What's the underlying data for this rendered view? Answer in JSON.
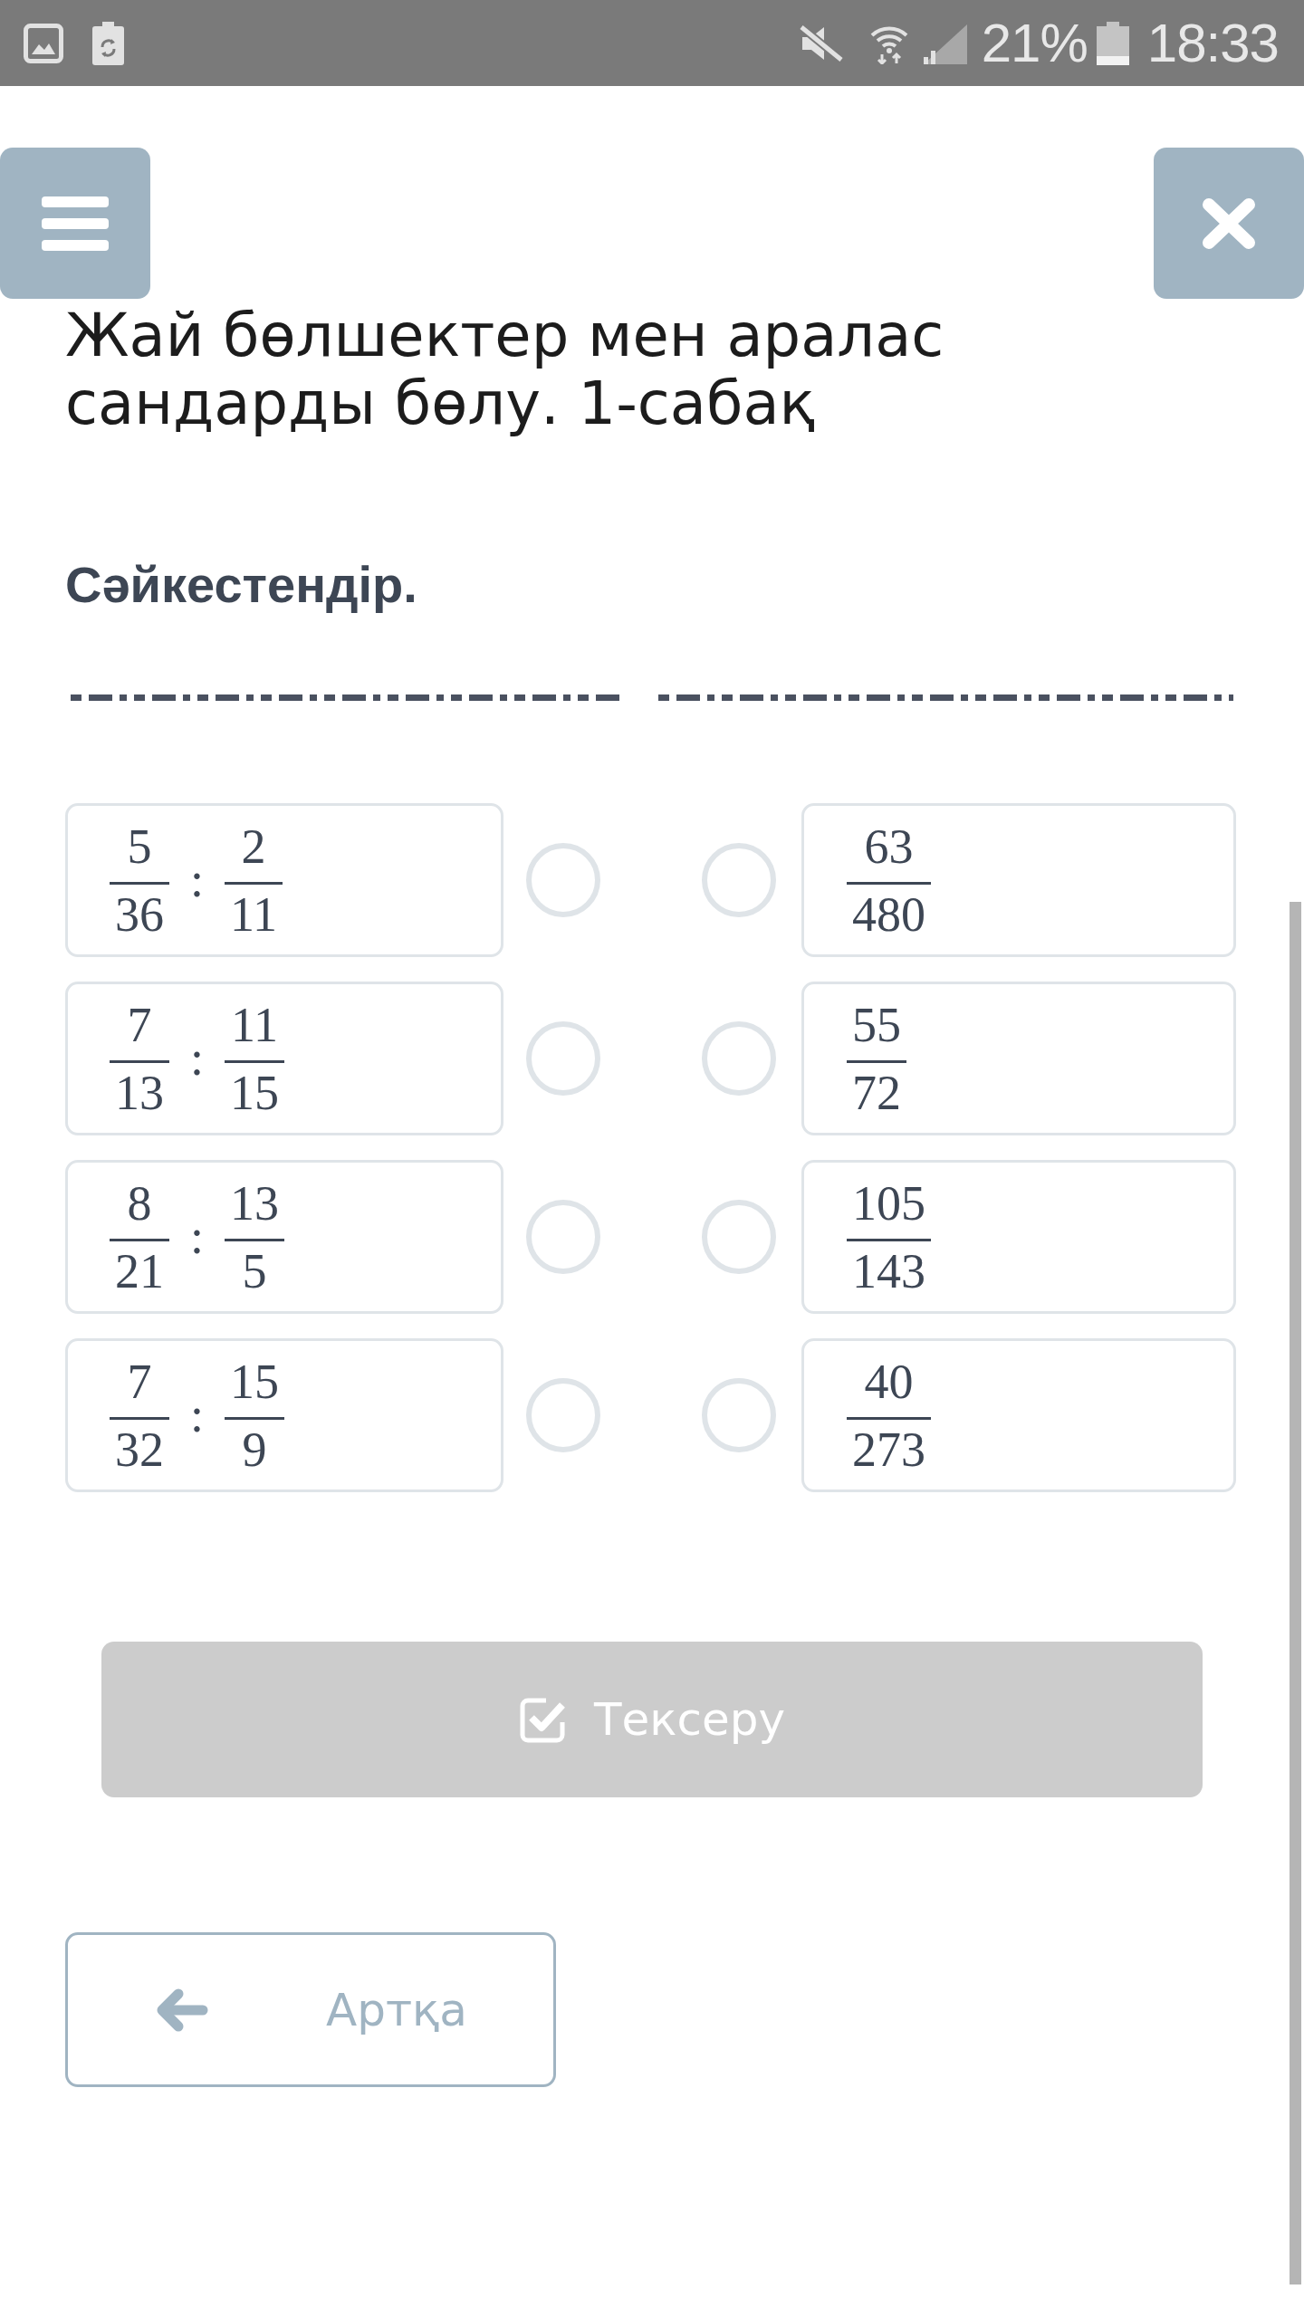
{
  "status_bar": {
    "battery_percent": "21%",
    "time": "18:33"
  },
  "title": "Жай бөлшектер мен аралас сандарды бөлу. 1-сабақ",
  "instruction": "Сәйкестендір.",
  "left_items": [
    {
      "selected": false,
      "terms": [
        {
          "kind": "fraction",
          "numerator": "5",
          "denominator": "36"
        },
        {
          "kind": "operator",
          "text": ":"
        },
        {
          "kind": "fraction",
          "numerator": "2",
          "denominator": "11"
        }
      ]
    },
    {
      "selected": false,
      "terms": [
        {
          "kind": "fraction",
          "numerator": "7",
          "denominator": "13"
        },
        {
          "kind": "operator",
          "text": ":"
        },
        {
          "kind": "fraction",
          "numerator": "11",
          "denominator": "15"
        }
      ]
    },
    {
      "selected": false,
      "terms": [
        {
          "kind": "fraction",
          "numerator": "8",
          "denominator": "21"
        },
        {
          "kind": "operator",
          "text": ":"
        },
        {
          "kind": "fraction",
          "numerator": "13",
          "denominator": "5"
        }
      ]
    },
    {
      "selected": false,
      "terms": [
        {
          "kind": "fraction",
          "numerator": "7",
          "denominator": "32"
        },
        {
          "kind": "operator",
          "text": ":"
        },
        {
          "kind": "fraction",
          "numerator": "15",
          "denominator": "9"
        }
      ]
    }
  ],
  "right_items": [
    {
      "selected": false,
      "terms": [
        {
          "kind": "fraction",
          "numerator": "63",
          "denominator": "480"
        }
      ]
    },
    {
      "selected": false,
      "terms": [
        {
          "kind": "fraction",
          "numerator": "55",
          "denominator": "72"
        }
      ]
    },
    {
      "selected": false,
      "terms": [
        {
          "kind": "fraction",
          "numerator": "105",
          "denominator": "143"
        }
      ]
    },
    {
      "selected": false,
      "terms": [
        {
          "kind": "fraction",
          "numerator": "40",
          "denominator": "273"
        }
      ]
    }
  ],
  "check_button": {
    "label": "Тексеру",
    "disabled": true
  },
  "back_button": {
    "label": "Артқа"
  }
}
